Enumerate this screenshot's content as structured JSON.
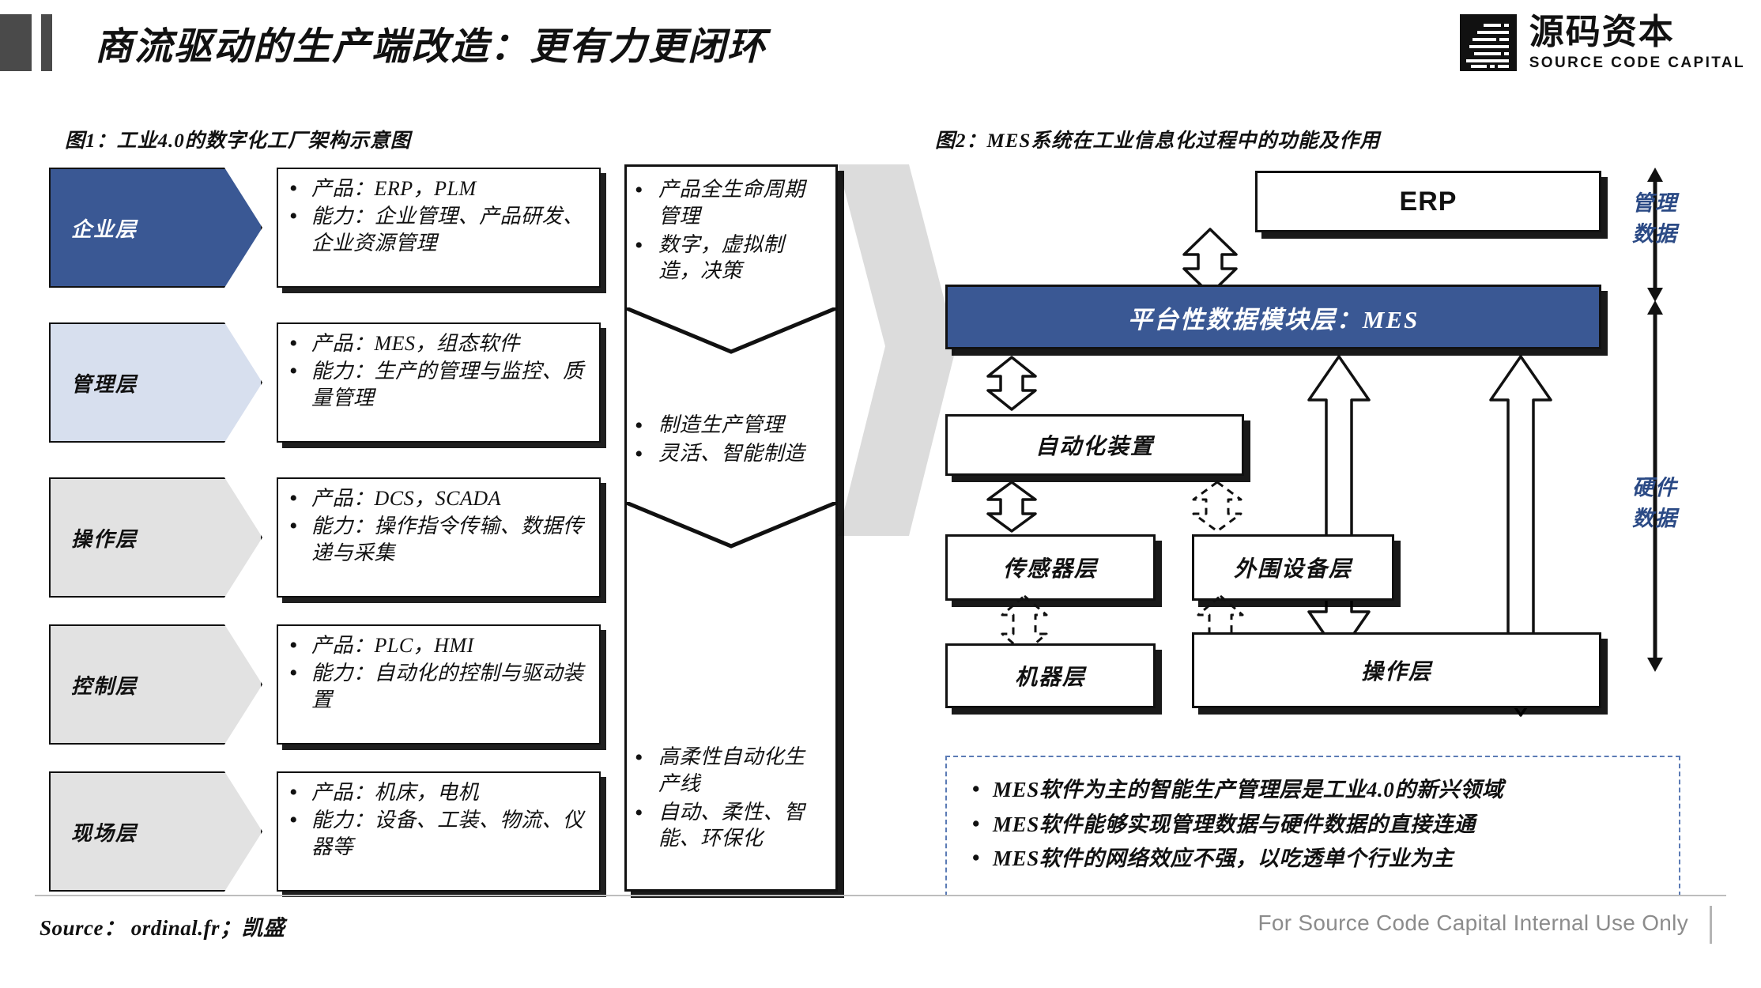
{
  "header": {
    "title": "商流驱动的生产端改造：更有力更闭环",
    "logo_cn": "源码资本",
    "logo_en": "SOURCE CODE CAPITAL",
    "logo_mark_name": "source-code-capital-logo"
  },
  "figure1": {
    "caption": "图1：工业4.0的数字化工厂架构示意图",
    "layers": [
      {
        "name": "企业层",
        "style": "dark",
        "details": [
          "产品：ERP，PLM",
          "能力：企业管理、产品研发、企业资源管理"
        ]
      },
      {
        "name": "管理层",
        "style": "light",
        "details": [
          "产品：MES，组态软件",
          "能力：生产的管理与监控、质量管理"
        ]
      },
      {
        "name": "操作层",
        "style": "grey",
        "details": [
          "产品：DCS，SCADA",
          "能力：操作指令传输、数据传递与采集"
        ]
      },
      {
        "name": "控制层",
        "style": "grey",
        "details": [
          "产品：PLC，HMI",
          "能力：自动化的控制与驱动装置"
        ]
      },
      {
        "name": "现场层",
        "style": "grey",
        "details": [
          "产品：机床，电机",
          "能力：设备、工装、物流、仪器等"
        ]
      }
    ],
    "outcome_segments": [
      {
        "bullets": [
          "产品全生命周期管理",
          "数字，虚拟制造，决策"
        ]
      },
      {
        "bullets": [
          "制造生产管理",
          "灵活、智能制造"
        ]
      },
      {
        "bullets": [
          "高柔性自动化生产线",
          "自动、柔性、智能、环保化"
        ]
      }
    ]
  },
  "figure2": {
    "caption": "图2：MES系统在工业信息化过程中的功能及作用",
    "erp_label": "ERP",
    "mes_label": "平台性数据模块层：MES",
    "boxes": [
      {
        "id": "automation",
        "label": "自动化装置"
      },
      {
        "id": "sensor",
        "label": "传感器层"
      },
      {
        "id": "peripheral",
        "label": "外围设备层"
      },
      {
        "id": "machine",
        "label": "机器层"
      },
      {
        "id": "operation",
        "label": "操作层"
      }
    ],
    "side_labels": [
      {
        "id": "management-data",
        "text": "管理\n数据"
      },
      {
        "id": "hardware-data",
        "text": "硬件\n数据"
      }
    ],
    "side_label_management": "管理",
    "side_label_management2": "数据",
    "side_label_hardware": "硬件",
    "side_label_hardware2": "数据",
    "notes": [
      "MES软件为主的智能生产管理层是工业4.0的新兴领域",
      "MES软件能够实现管理数据与硬件数据的直接连通",
      "MES软件的网络效应不强，以吃透单个行业为主"
    ]
  },
  "footer": {
    "source": "Source： ordinal.fr；凯盛",
    "confidential": "For Source Code Capital Internal Use Only"
  },
  "colors": {
    "brand_blue": "#3a5894",
    "light_blue": "#d7dfee",
    "grey_fill": "#e2e2e2",
    "label_blue": "#2b4a85",
    "header_bar": "#4a4a4a"
  }
}
